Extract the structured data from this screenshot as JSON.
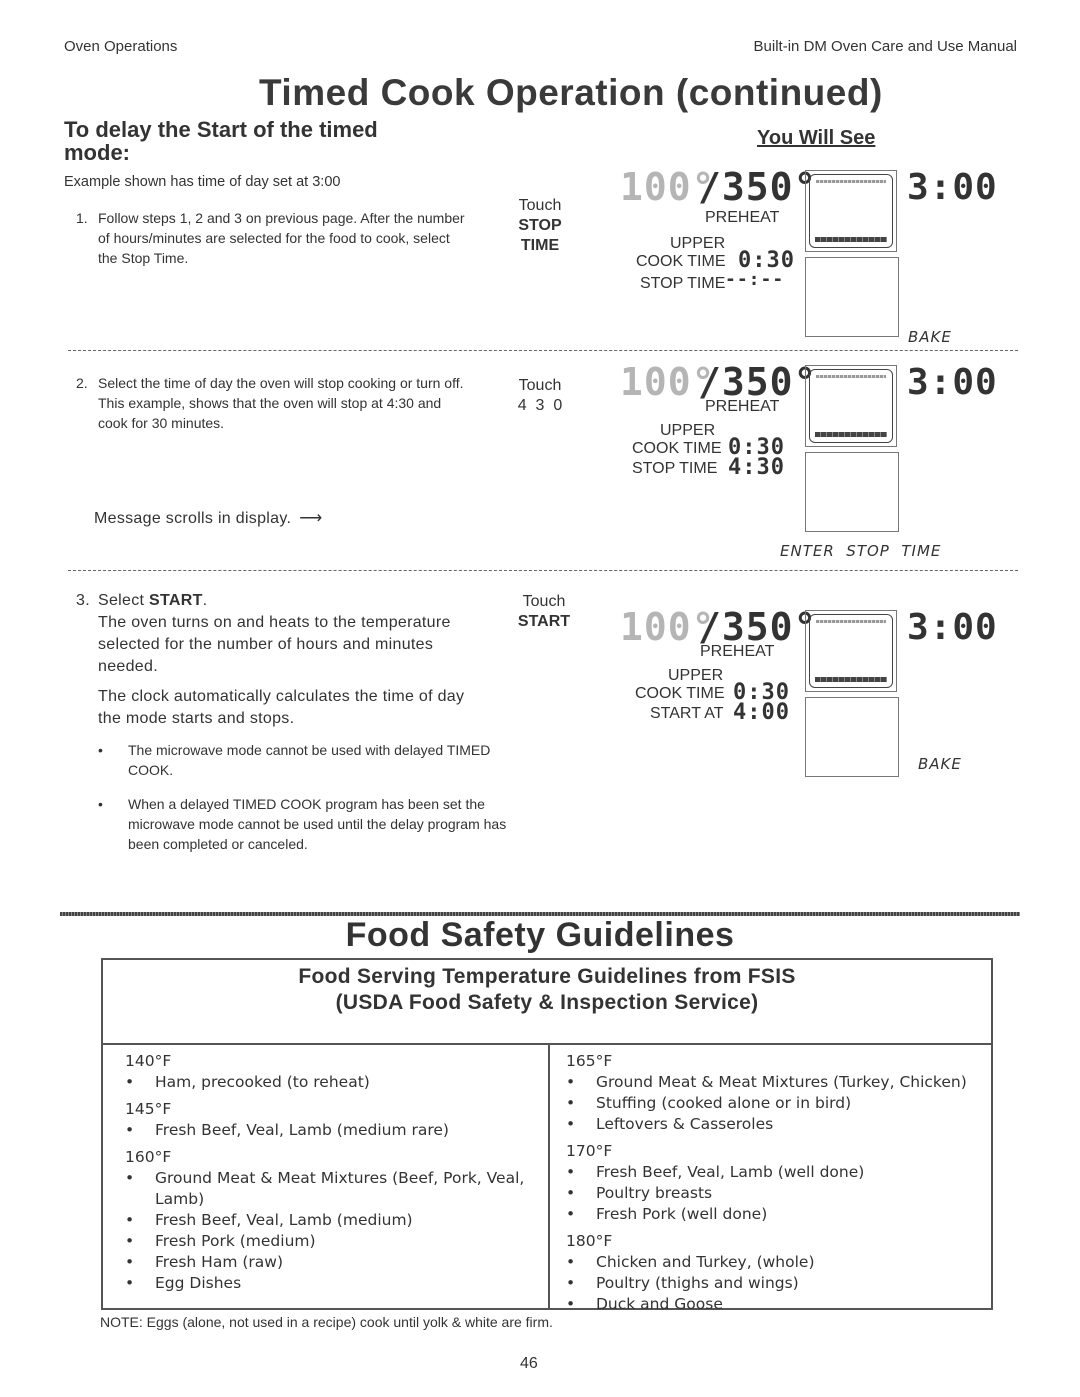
{
  "header": {
    "section": "Oven Operations",
    "manual": "Built-in DM Oven Care and Use Manual"
  },
  "title": "Timed Cook Operation (continued)",
  "subheading": "To delay the Start of the timed mode:",
  "subheading_line1": "To delay the Start of the timed",
  "subheading_line2": "mode:",
  "example_note": "Example shown has time of day set at 3:00",
  "you_will_see": "You Will See",
  "steps": [
    {
      "number": "1.",
      "text": "Follow steps 1, 2 and 3 on previous page.  After the number of hours/minutes are selected for the food to cook, select the Stop Time.",
      "touch_label": "Touch",
      "touch_keys": [
        "STOP",
        "TIME"
      ],
      "display": {
        "oven_temp": "100°",
        "set_temp": "/350°",
        "clock": "3:00",
        "status": "PREHEAT",
        "rack": "UPPER",
        "cook_time_label": "COOK TIME",
        "cook_time_value": "0:30",
        "second_label": "STOP TIME",
        "second_value": "--:--",
        "mode_message": "BAKE"
      }
    },
    {
      "number": "2.",
      "text": "Select the time of day the oven will stop cooking or turn off.  This example, shows that the oven will stop at 4:30 and cook for 30 minutes.",
      "touch_label": "Touch",
      "touch_keys": [
        "4  3  0"
      ],
      "scroll_note": "Message scrolls in display.",
      "scroll_arrow": "⟶",
      "display": {
        "oven_temp": "100°",
        "set_temp": "/350°",
        "clock": "3:00",
        "status": "PREHEAT",
        "rack": "UPPER",
        "cook_time_label": "COOK TIME",
        "cook_time_value": "0:30",
        "second_label": "STOP TIME",
        "second_value": "4:30",
        "mode_message": "ENTER  STOP  TIME"
      }
    },
    {
      "number": "3.",
      "text_prefix": "Select ",
      "text_bold": "START",
      "text_suffix": ".",
      "paragraph1": "The oven turns on and heats to the temperature selected for the number of hours and minutes needed.",
      "paragraph2": "The clock automatically calculates the time of day the mode starts and stops.",
      "bullets": [
        "The microwave mode cannot be used with delayed TIMED COOK.",
        "When a delayed TIMED COOK program has been set the microwave mode cannot be used until the delay program has been completed or canceled."
      ],
      "touch_label": "Touch",
      "touch_keys": [
        "START"
      ],
      "display": {
        "oven_temp": "100°",
        "set_temp": "/350°",
        "clock": "3:00",
        "status": "PREHEAT",
        "rack": "UPPER",
        "cook_time_label": "COOK TIME",
        "cook_time_value": "0:30",
        "second_label": "START AT",
        "second_value": "4:00",
        "mode_message": "BAKE"
      }
    }
  ],
  "food_safety": {
    "title": "Food Safety Guidelines",
    "table_title_line1": "Food Serving Temperature Guidelines from FSIS",
    "table_title_line2": "(USDA Food Safety & Inspection Service)",
    "left_column": [
      {
        "temp": "140°F",
        "items": [
          "Ham, precooked (to reheat)"
        ]
      },
      {
        "temp": "145°F",
        "items": [
          "Fresh Beef, Veal, Lamb (medium rare)"
        ]
      },
      {
        "temp": "160°F",
        "items": [
          "Ground Meat & Meat Mixtures (Beef, Pork, Veal, Lamb)",
          "Fresh Beef, Veal, Lamb (medium)",
          "Fresh Pork (medium)",
          "Fresh Ham (raw)",
          "Egg  Dishes"
        ]
      }
    ],
    "right_column": [
      {
        "temp": "165°F",
        "items": [
          "Ground Meat & Meat Mixtures (Turkey, Chicken)",
          "Stuffing (cooked alone or in bird)",
          "Leftovers & Casseroles"
        ]
      },
      {
        "temp": "170°F",
        "items": [
          "Fresh Beef, Veal, Lamb (well done)",
          "Poultry breasts",
          "Fresh Pork (well done)"
        ]
      },
      {
        "temp": "180°F",
        "items": [
          "Chicken and Turkey, (whole)",
          "Poultry (thighs and wings)",
          "Duck and  Goose"
        ]
      }
    ],
    "note": "NOTE: Eggs (alone, not used in a recipe) cook until yolk & white are firm."
  },
  "page_number": "46"
}
